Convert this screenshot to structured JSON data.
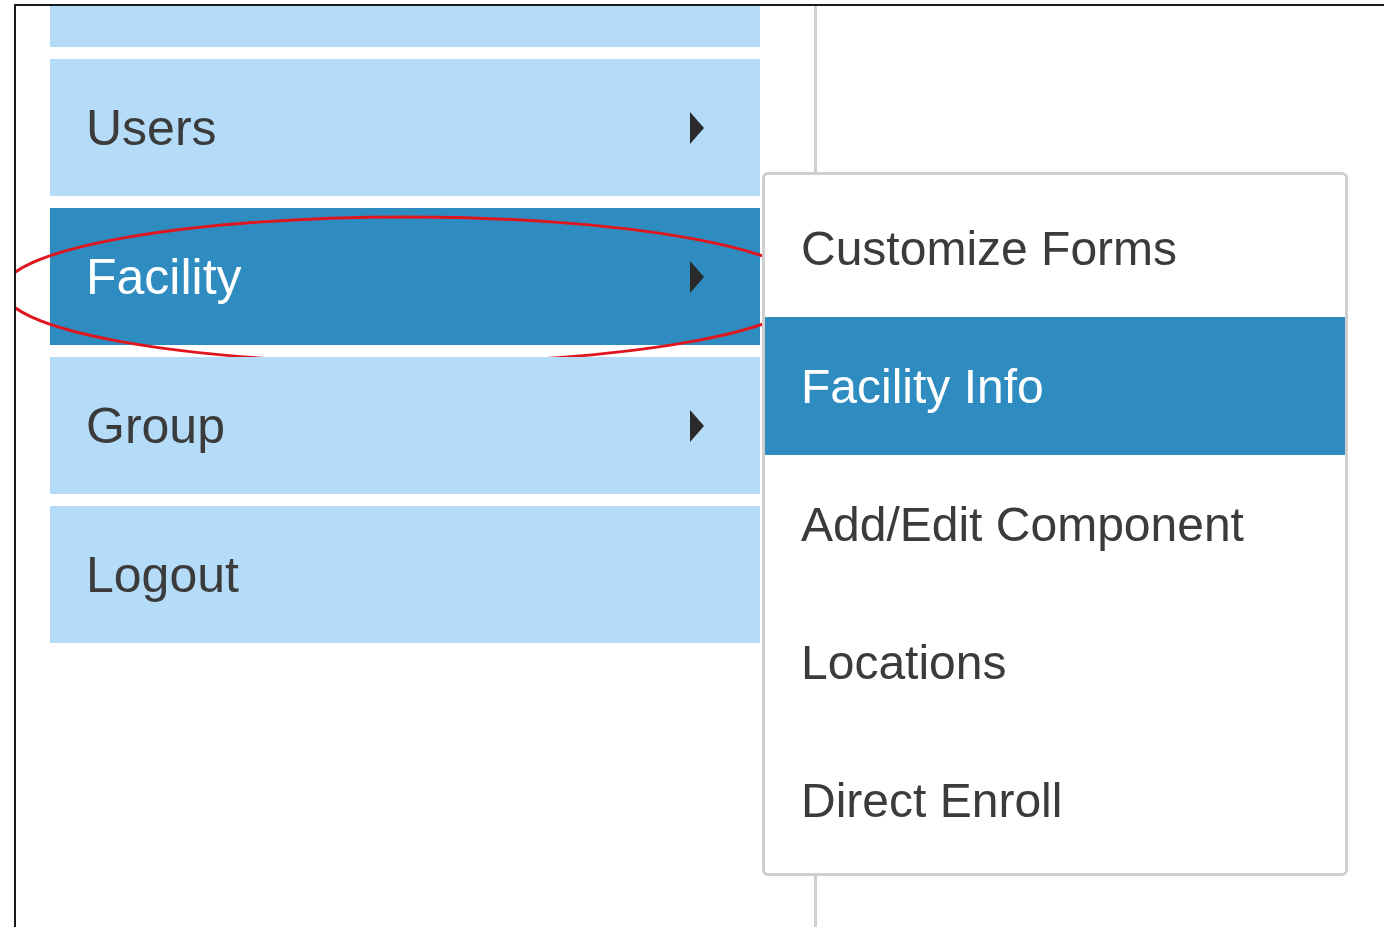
{
  "menu": {
    "items": [
      {
        "has_submenu": false,
        "selected": false,
        "circled": false
      },
      {
        "label": "Users",
        "has_submenu": true,
        "selected": false,
        "circled": false
      },
      {
        "label": "Facility",
        "has_submenu": true,
        "selected": true,
        "circled": true
      },
      {
        "label": "Group",
        "has_submenu": true,
        "selected": false,
        "circled": false
      },
      {
        "label": "Logout",
        "has_submenu": false,
        "selected": false,
        "circled": false
      }
    ]
  },
  "submenu": {
    "items": [
      {
        "label": "Customize Forms",
        "selected": false
      },
      {
        "label": "Facility Info",
        "selected": true
      },
      {
        "label": "Add/Edit Component",
        "selected": false
      },
      {
        "label": "Locations",
        "selected": false
      },
      {
        "label": "Direct Enroll",
        "selected": false
      }
    ]
  }
}
